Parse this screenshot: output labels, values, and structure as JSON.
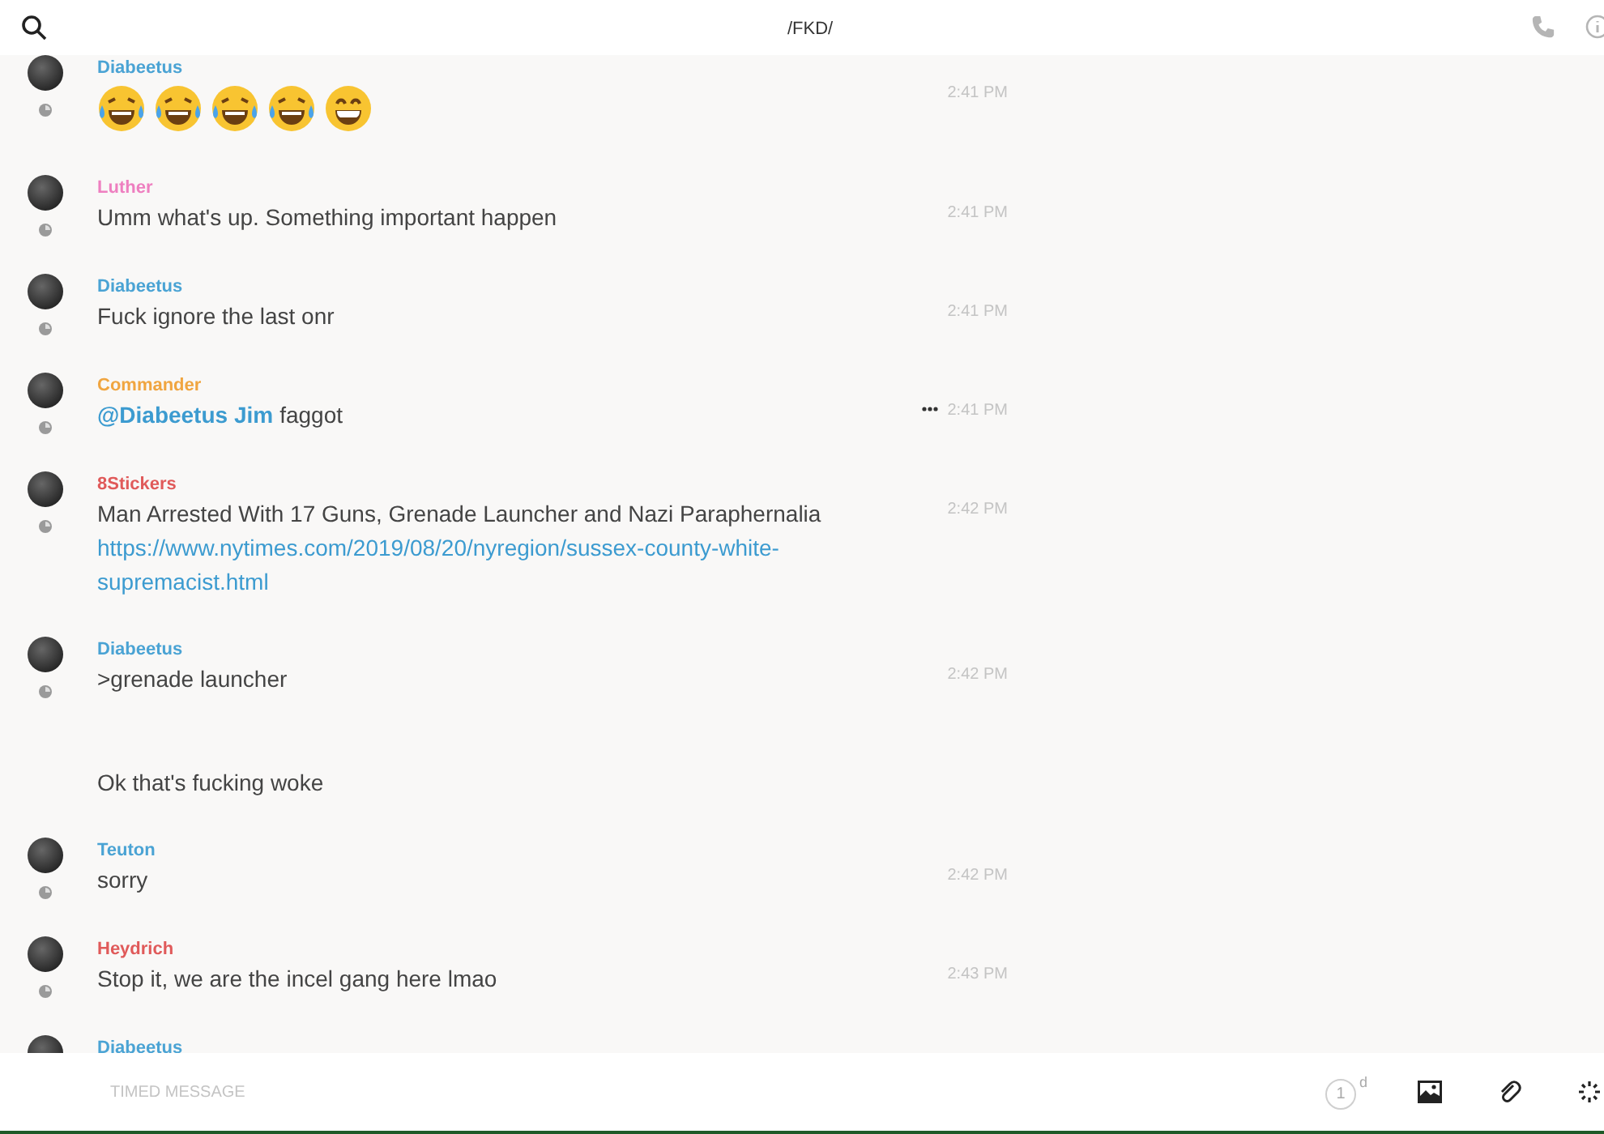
{
  "header": {
    "title": "/FKD/"
  },
  "messages": [
    {
      "author": "Diabeetus",
      "color": "#4aa3d4",
      "time": "2:41 PM",
      "kind": "emoji",
      "emoji": [
        {
          "kind": "laughing"
        },
        {
          "kind": "laughing"
        },
        {
          "kind": "laughing"
        },
        {
          "kind": "laughing"
        },
        {
          "kind": "grinning"
        }
      ]
    },
    {
      "author": "Luther",
      "color": "#ee7fc0",
      "time": "2:41 PM",
      "kind": "text",
      "text": "Umm what's up. Something important happen"
    },
    {
      "author": "Diabeetus",
      "color": "#4aa3d4",
      "time": "2:41 PM",
      "kind": "text",
      "text": "Fuck ignore the last onr"
    },
    {
      "author": "Commander",
      "color": "#f0a540",
      "time": "2:41 PM",
      "kind": "mention",
      "hovered": true,
      "mention": "@Diabeetus Jim",
      "text": "faggot"
    },
    {
      "author": "8Stickers",
      "color": "#e05a5a",
      "time": "2:42 PM",
      "kind": "link",
      "text": "Man Arrested With 17 Guns, Grenade Launcher and Nazi Paraphernalia",
      "link_lines": [
        "https://www.nytimes.com/2019/08/20/nyregion/sussex-county-white-",
        "supremacist.html"
      ]
    },
    {
      "author": "Diabeetus",
      "color": "#4aa3d4",
      "time": "2:42 PM",
      "kind": "text",
      "text": ">grenade launcher"
    },
    {
      "kind": "continuation",
      "text": "Ok that's fucking woke"
    },
    {
      "author": "Teuton",
      "color": "#4aa3d4",
      "time": "2:42 PM",
      "kind": "text",
      "text": "sorry"
    },
    {
      "author": "Heydrich",
      "color": "#e05a5a",
      "time": "2:43 PM",
      "kind": "text",
      "text": "Stop it, we are the incel gang here lmao"
    },
    {
      "author": "Diabeetus",
      "color": "#4aa3d4",
      "kind": "partial"
    }
  ],
  "composer": {
    "placeholder": "TIMED MESSAGE",
    "timer_value": "1",
    "timer_unit": "d"
  }
}
